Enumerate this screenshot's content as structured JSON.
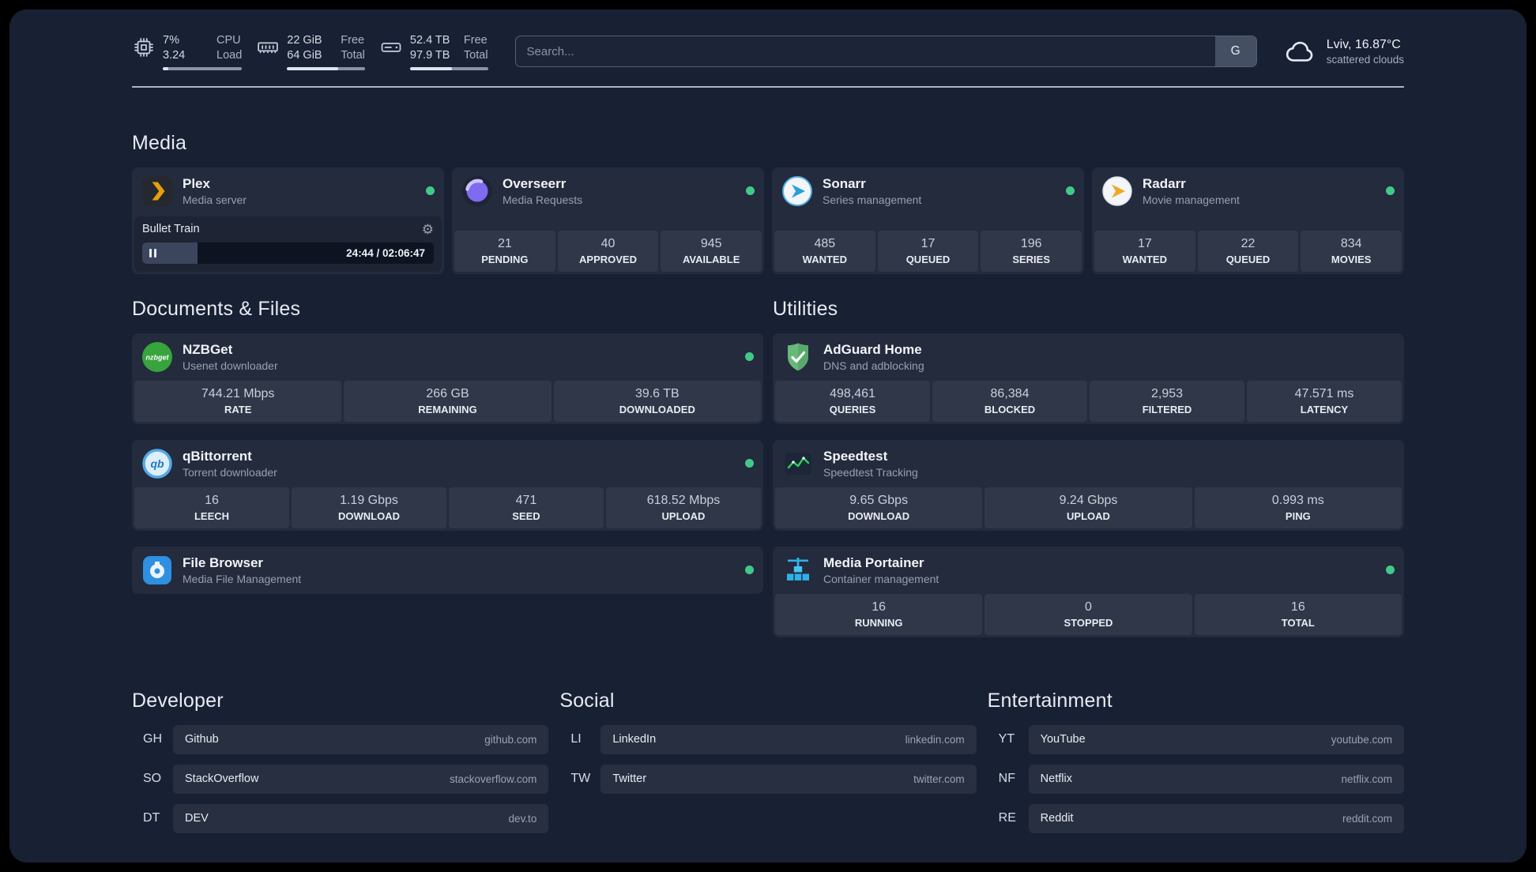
{
  "topbar": {
    "resources": [
      {
        "value1": "7%",
        "value2": "3.24",
        "label1": "CPU",
        "label2": "Load",
        "percent": 7
      },
      {
        "value1": "22 GiB",
        "value2": "64 GiB",
        "label1": "Free",
        "label2": "Total",
        "percent": 66
      },
      {
        "value1": "52.4 TB",
        "value2": "97.9 TB",
        "label1": "Free",
        "label2": "Total",
        "percent": 54
      }
    ],
    "search": {
      "placeholder": "Search...",
      "button_label": "G"
    },
    "weather": {
      "location": "Lviv, 16.87°C",
      "condition": "scattered clouds"
    }
  },
  "groups": {
    "media": "Media",
    "documents": "Documents & Files",
    "utilities": "Utilities",
    "developer": "Developer",
    "social": "Social",
    "entertainment": "Entertainment"
  },
  "services": {
    "plex": {
      "name": "Plex",
      "subtitle": "Media server",
      "status": "online",
      "player": {
        "title": "Bullet Train",
        "time": "24:44 / 02:06:47",
        "progress_percent": 19
      }
    },
    "overseerr": {
      "name": "Overseerr",
      "subtitle": "Media Requests",
      "status": "online",
      "stats": [
        {
          "value": "21",
          "label": "PENDING"
        },
        {
          "value": "40",
          "label": "APPROVED"
        },
        {
          "value": "945",
          "label": "AVAILABLE"
        }
      ]
    },
    "sonarr": {
      "name": "Sonarr",
      "subtitle": "Series management",
      "status": "online",
      "stats": [
        {
          "value": "485",
          "label": "WANTED"
        },
        {
          "value": "17",
          "label": "QUEUED"
        },
        {
          "value": "196",
          "label": "SERIES"
        }
      ]
    },
    "radarr": {
      "name": "Radarr",
      "subtitle": "Movie management",
      "status": "online",
      "stats": [
        {
          "value": "17",
          "label": "WANTED"
        },
        {
          "value": "22",
          "label": "QUEUED"
        },
        {
          "value": "834",
          "label": "MOVIES"
        }
      ]
    },
    "nzbget": {
      "name": "NZBGet",
      "subtitle": "Usenet downloader",
      "status": "online",
      "stats": [
        {
          "value": "744.21 Mbps",
          "label": "RATE"
        },
        {
          "value": "266 GB",
          "label": "REMAINING"
        },
        {
          "value": "39.6 TB",
          "label": "DOWNLOADED"
        }
      ]
    },
    "qbittorrent": {
      "name": "qBittorrent",
      "subtitle": "Torrent downloader",
      "status": "online",
      "stats": [
        {
          "value": "16",
          "label": "LEECH"
        },
        {
          "value": "1.19 Gbps",
          "label": "DOWNLOAD"
        },
        {
          "value": "471",
          "label": "SEED"
        },
        {
          "value": "618.52 Mbps",
          "label": "UPLOAD"
        }
      ]
    },
    "filebrowser": {
      "name": "File Browser",
      "subtitle": "Media File Management",
      "status": "online"
    },
    "adguard": {
      "name": "AdGuard Home",
      "subtitle": "DNS and adblocking",
      "status": "online",
      "stats": [
        {
          "value": "498,461",
          "label": "QUERIES"
        },
        {
          "value": "86,384",
          "label": "BLOCKED"
        },
        {
          "value": "2,953",
          "label": "FILTERED"
        },
        {
          "value": "47.571 ms",
          "label": "LATENCY"
        }
      ]
    },
    "speedtest": {
      "name": "Speedtest",
      "subtitle": "Speedtest Tracking",
      "status": "online",
      "stats": [
        {
          "value": "9.65 Gbps",
          "label": "DOWNLOAD"
        },
        {
          "value": "9.24 Gbps",
          "label": "UPLOAD"
        },
        {
          "value": "0.993 ms",
          "label": "PING"
        }
      ]
    },
    "portainer": {
      "name": "Media Portainer",
      "subtitle": "Container management",
      "status": "online",
      "stats": [
        {
          "value": "16",
          "label": "RUNNING"
        },
        {
          "value": "0",
          "label": "STOPPED"
        },
        {
          "value": "16",
          "label": "TOTAL"
        }
      ]
    }
  },
  "bookmarks": {
    "developer": [
      {
        "abbr": "GH",
        "name": "Github",
        "url": "github.com"
      },
      {
        "abbr": "SO",
        "name": "StackOverflow",
        "url": "stackoverflow.com"
      },
      {
        "abbr": "DT",
        "name": "DEV",
        "url": "dev.to"
      }
    ],
    "social": [
      {
        "abbr": "LI",
        "name": "LinkedIn",
        "url": "linkedin.com"
      },
      {
        "abbr": "TW",
        "name": "Twitter",
        "url": "twitter.com"
      }
    ],
    "entertainment": [
      {
        "abbr": "YT",
        "name": "YouTube",
        "url": "youtube.com"
      },
      {
        "abbr": "NF",
        "name": "Netflix",
        "url": "netflix.com"
      },
      {
        "abbr": "RE",
        "name": "Reddit",
        "url": "reddit.com"
      }
    ]
  },
  "colors": {
    "status_online": "#41c98a",
    "plex_amber": "#e5a00d",
    "background": "#182033"
  }
}
